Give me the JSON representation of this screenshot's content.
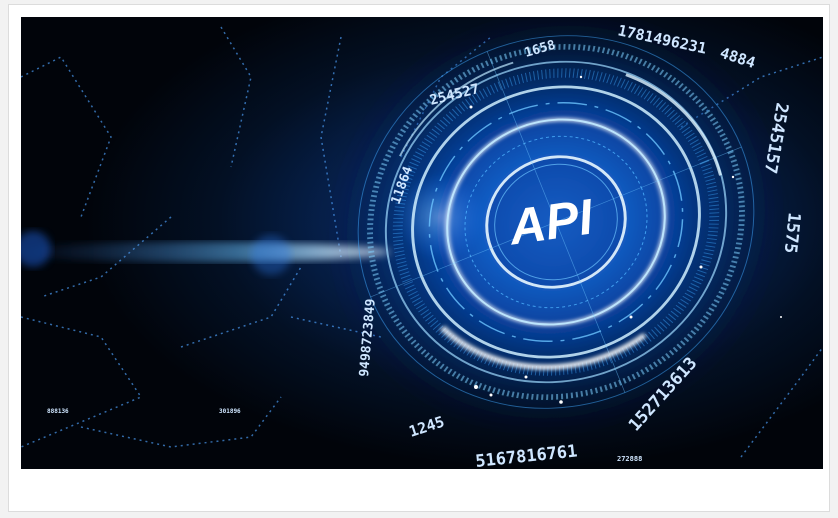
{
  "image": {
    "main_label": "API",
    "digit_strings": {
      "top_right": "1781496231",
      "top_mid": "4884",
      "top_left": "254527",
      "top_small": "1658",
      "left_vertical": "11864",
      "left_arc": "9498723849",
      "right_vertical": "2545157",
      "right_mid": "1575",
      "bottom_arc": "5167816761",
      "bottom_right": "152713613",
      "bottom_small": "1245",
      "tiny_left": "888136",
      "tiny_mid": "301896",
      "tiny_right": "272888"
    }
  },
  "colors": {
    "background": "#02060f",
    "glow": "#3fa9ff",
    "ring": "#7fd0ff",
    "text": "#ffffff"
  }
}
